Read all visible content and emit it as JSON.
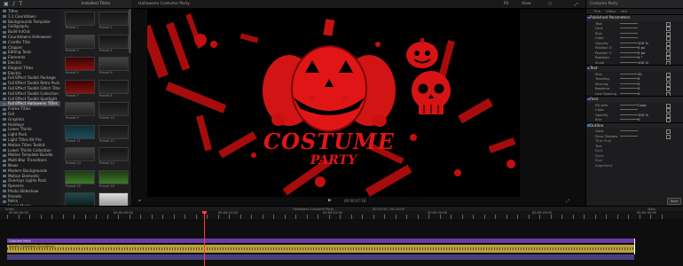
{
  "library": {
    "toolbar_icons": [
      "film-icon",
      "music-icon",
      "text-icon"
    ],
    "items": [
      "Titles",
      "1.1 Countdown",
      "Backgrounds Template",
      "Calligraphy",
      "Build In/Out",
      "Countdowns Halloween",
      "Credits Title",
      "Clapper",
      "Editing Tools",
      "Elements",
      "Electric",
      "Elegant Titles",
      "Electro",
      "Fall Effect Toolkit Package",
      "Fall Effect Toolkit Retro Pack",
      "Fall Effect Toolkit Glitch Title",
      "Fall Effect Toolkit Collection 2",
      "Fall Effect Toolkit Spotlight",
      "Fall Effect Halloween Titles",
      "Frame Titles",
      "Fall",
      "Graphics",
      "Holidays",
      "Lower Thirds",
      "Light Pack",
      "Light Titles Kit Pro",
      "Motion Titles Toolkit",
      "Lower Thirds Collection",
      "Motion Template Bundle",
      "Multi-Blur Transitions",
      "News",
      "Modern Backgrounds",
      "Motion Elements",
      "Overlays Lights Pack",
      "Openers",
      "Photo Slideshow",
      "Presets",
      "Retro",
      "Social Media"
    ],
    "selected_index": 18
  },
  "browser": {
    "header": "Installed Titles",
    "thumbs": [
      {
        "caption": "Preset 1",
        "style": "t-dark"
      },
      {
        "caption": "Preset 2",
        "style": "t-dark"
      },
      {
        "caption": "Preset 3",
        "style": "t-grey"
      },
      {
        "caption": "Preset 4",
        "style": "t-dark"
      },
      {
        "caption": "Preset 5",
        "style": "t-red"
      },
      {
        "caption": "Preset 6",
        "style": "t-grey"
      },
      {
        "caption": "Preset 7",
        "style": "t-red"
      },
      {
        "caption": "Preset 8",
        "style": "t-dark"
      },
      {
        "caption": "Preset 9",
        "style": "t-grey"
      },
      {
        "caption": "Preset 10",
        "style": "t-dark"
      },
      {
        "caption": "Preset 11",
        "style": "t-blue"
      },
      {
        "caption": "Preset 12",
        "style": "t-dark"
      },
      {
        "caption": "Preset 13",
        "style": "t-grey"
      },
      {
        "caption": "Preset 14",
        "style": "t-dark"
      },
      {
        "caption": "Preset 15",
        "style": "t-green"
      },
      {
        "caption": "Preset 16",
        "style": "t-green"
      },
      {
        "caption": "Preset 17",
        "style": "t-teal"
      },
      {
        "caption": "Preset 18",
        "style": "t-white"
      }
    ]
  },
  "viewer": {
    "title": "Halloween Costume Party",
    "zoom": "Fit",
    "view_label": "View",
    "timecode": "00:00:07:18",
    "title_text": "COSTUME",
    "subtitle_text": "PARTY"
  },
  "inspector": {
    "header": "Costume Party",
    "tabs": [
      "Title",
      "Video",
      "Info"
    ],
    "sections": [
      {
        "title": "Published Parameters",
        "rows": [
          [
            "Text",
            ""
          ],
          [
            "Font",
            ""
          ],
          [
            "Size",
            ""
          ],
          [
            "Color",
            ""
          ],
          [
            "Opacity",
            "100 %"
          ],
          [
            "Position X",
            "0 px"
          ],
          [
            "Position Y",
            "0 px"
          ],
          [
            "Rotation",
            "0 °"
          ],
          [
            "Scale",
            "100 %"
          ]
        ]
      },
      {
        "title": "Text",
        "rows": [
          [
            "Size",
            "32"
          ],
          [
            "Tracking",
            "0"
          ],
          [
            "Kerning",
            "0"
          ],
          [
            "Baseline",
            "0"
          ],
          [
            "Line Spacing",
            "0"
          ]
        ]
      },
      {
        "title": "Face",
        "rows": [
          [
            "Fill with",
            "Color"
          ],
          [
            "Color",
            ""
          ],
          [
            "Opacity",
            "100 %"
          ],
          [
            "Blur",
            "0"
          ]
        ]
      },
      {
        "title": "Outline",
        "rows": [
          [
            "Glow",
            ""
          ],
          [
            "Drop Shadow",
            ""
          ]
        ]
      }
    ],
    "lower": [
      "Title Only",
      "Text",
      "Font",
      "Style",
      "Size",
      "Alignment"
    ],
    "save_label": "Save"
  },
  "timeline": {
    "bar_labels": [
      "Index",
      "Halloween Costume Party",
      "00:10:00 / 00:20:00",
      "Tools"
    ],
    "ruler_labels": [
      "00:00:00:00",
      "00:00:05:00",
      "00:00:10:00",
      "00:00:15:00",
      "00:00:20:00",
      "00:00:25:00",
      "00:00:30:00"
    ],
    "video_clip": "Costume Party",
    "audio_clip": "Spooky Halloween Soundtrack"
  },
  "colors": {
    "accent_red": "#e01313",
    "playhead": "#ff3a3a",
    "clip_purple": "#6a3aa8",
    "clip_audio": "#b9a33a"
  }
}
